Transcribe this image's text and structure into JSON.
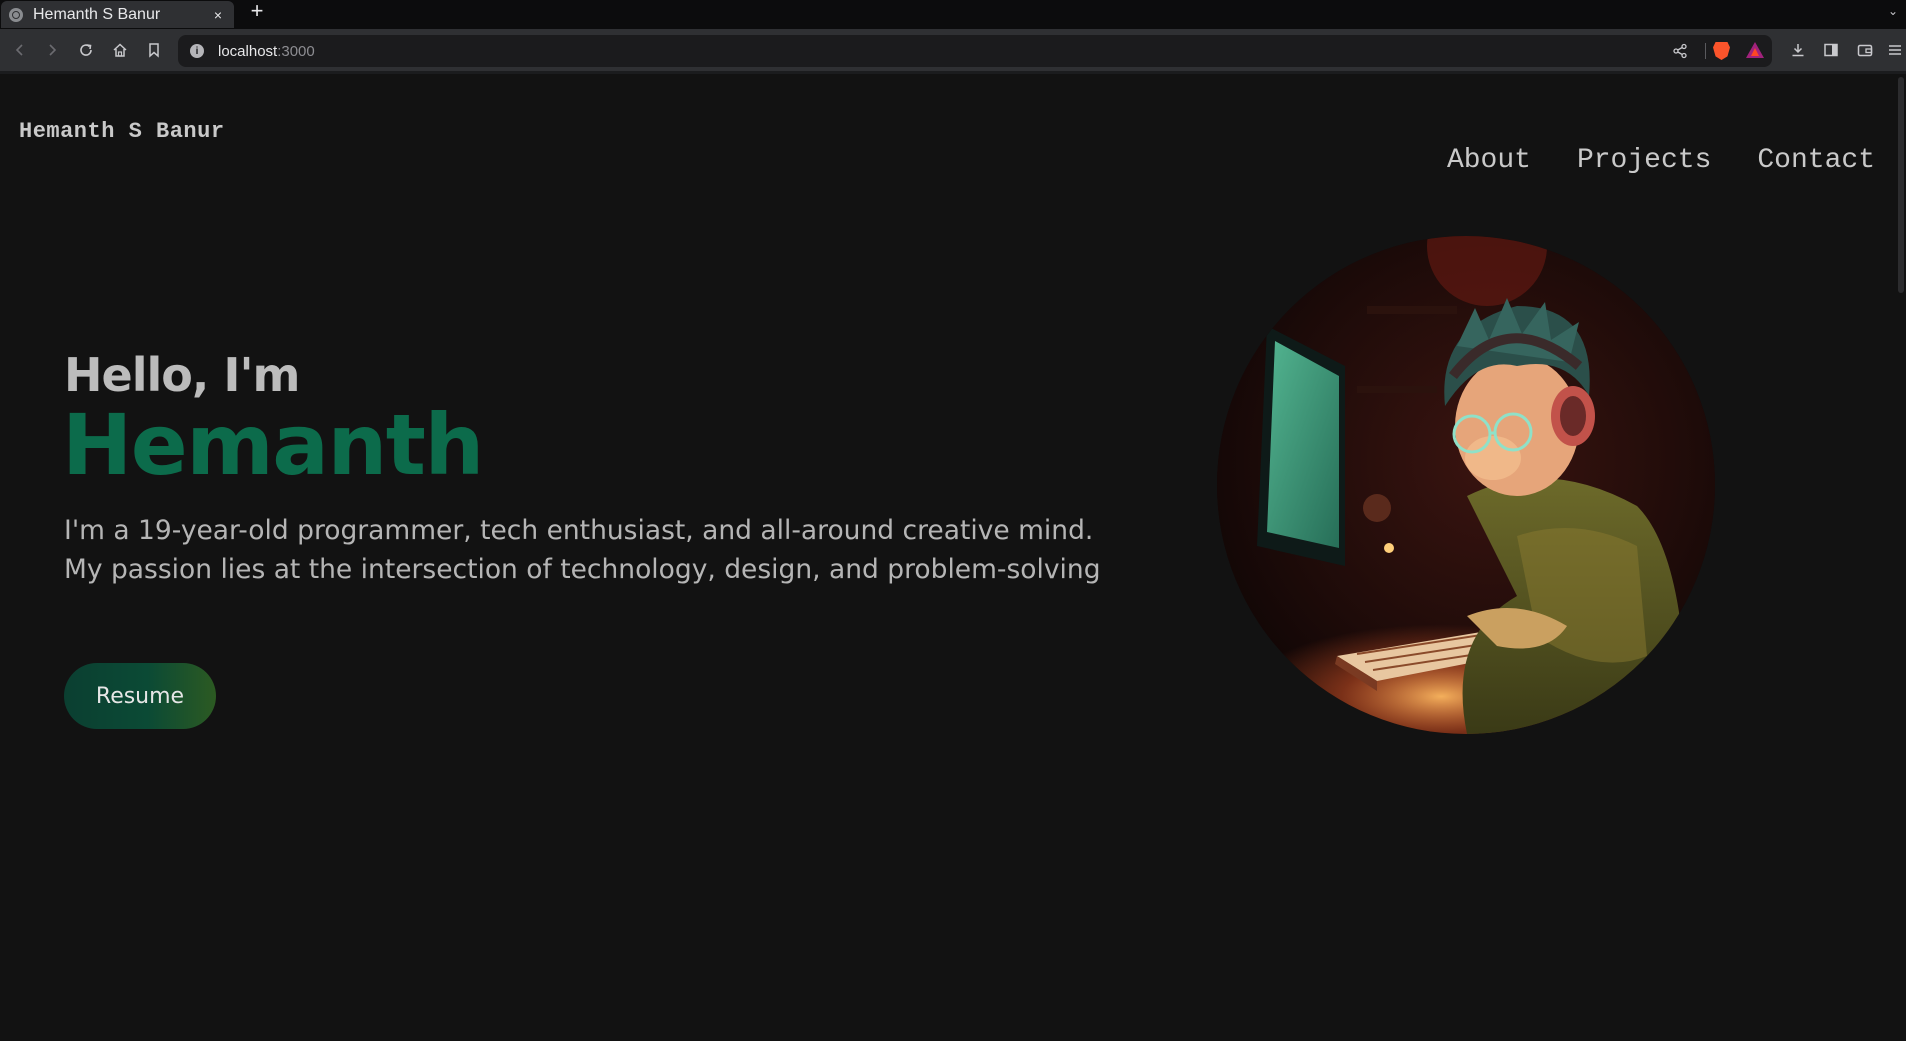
{
  "browser": {
    "tab_title": "Hemanth S Banur",
    "tab_close": "×",
    "new_tab": "+",
    "tabs_menu": "⌄",
    "url_host": "localhost",
    "url_port": ":3000"
  },
  "site": {
    "brand": "Hemanth S Banur",
    "nav": [
      {
        "label": "About"
      },
      {
        "label": "Projects"
      },
      {
        "label": "Contact"
      }
    ]
  },
  "hero": {
    "greeting": "Hello, I'm",
    "name": "Hemanth",
    "description": "I'm a 19-year-old programmer, tech enthusiast, and all-around creative mind. My passion lies at the intersection of technology, design, and problem-solving",
    "resume_label": "Resume"
  },
  "colors": {
    "background": "#121212",
    "accent": "#0c6b4b",
    "text": "#bcbcbc"
  },
  "icons": [
    "back-icon",
    "forward-icon",
    "reload-icon",
    "home-icon",
    "bookmark-icon",
    "info-icon",
    "share-icon",
    "brave-shields-icon",
    "brave-rewards-icon",
    "downloads-icon",
    "sidebar-icon",
    "wallet-icon",
    "menu-icon"
  ]
}
